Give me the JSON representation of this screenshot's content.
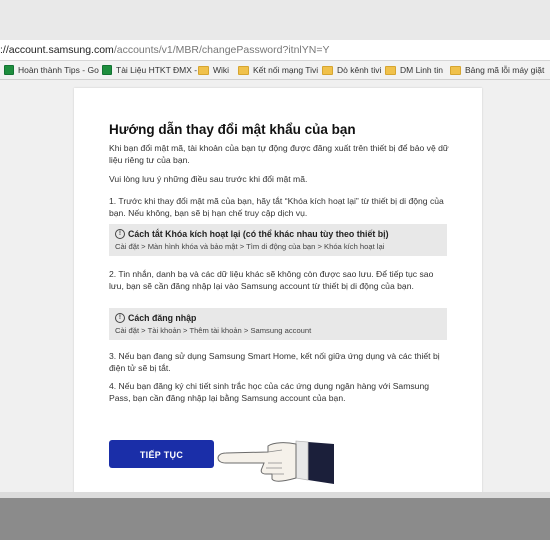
{
  "browser": {
    "url_host": "://account.samsung.com",
    "url_path": "/accounts/v1/MBR/changePassword?itnlYN=Y"
  },
  "bookmarks": [
    {
      "label": "Hoàn thành Tips - Go",
      "icon": "sheet-icon"
    },
    {
      "label": "Tài Liệu HTKT ĐMX -",
      "icon": "sheet-icon"
    },
    {
      "label": "Wiki",
      "icon": "folder-icon"
    },
    {
      "label": "Kết nối mạng Tivi",
      "icon": "folder-icon"
    },
    {
      "label": "Dò kênh tivi",
      "icon": "folder-icon"
    },
    {
      "label": "DM Linh tin",
      "icon": "folder-icon"
    },
    {
      "label": "Bảng mã lỗi máy giặt",
      "icon": "folder-icon"
    }
  ],
  "page": {
    "title": "Hướng dẫn thay đổi mật khẩu của bạn",
    "intro": "Khi bạn đổi mật mã, tài khoản của bạn tự động được đăng xuất trên thiết bị để bảo vệ dữ liệu riêng tư của bạn.",
    "notice": "Vui lòng lưu ý những điều sau trước khi đổi mật mã.",
    "item1": "1. Trước khi thay đổi mật mã của bạn, hãy tắt “Khóa kích hoạt lại” từ thiết bị di động của bạn. Nếu không, bạn sẽ bị hạn chế truy cập dịch vụ.",
    "note1_title": "Cách tắt Khóa kích hoạt lại (có thể khác nhau tùy theo thiết bị)",
    "note1_path": "Cài đặt > Màn hình khóa và bảo mật > Tìm di động của bạn > Khóa kích hoạt lại",
    "item2": "2. Tin nhắn, danh bạ và các dữ liệu khác sẽ không còn được sao lưu. Để tiếp tục sao lưu, bạn sẽ cần đăng nhập lại vào Samsung account từ thiết bị di động của bạn.",
    "note2_title": "Cách đăng nhập",
    "note2_path": "Cài đặt > Tài khoản > Thêm tài khoản > Samsung account",
    "item3": "3. Nếu bạn đang sử dụng Samsung Smart Home, kết nối giữa ứng dụng và các thiết bị điện tử sẽ bị tắt.",
    "item4": "4. Nếu bạn đăng ký chi tiết sinh trắc học của các ứng dụng ngân hàng với Samsung Pass, bạn cần đăng nhập lại bằng Samsung account của bạn.",
    "continue_label": "TIẾP TỤC",
    "info_icon_glyph": "!"
  },
  "colors": {
    "button": "#1a2ea8",
    "note_bg": "#e8e8e8"
  }
}
